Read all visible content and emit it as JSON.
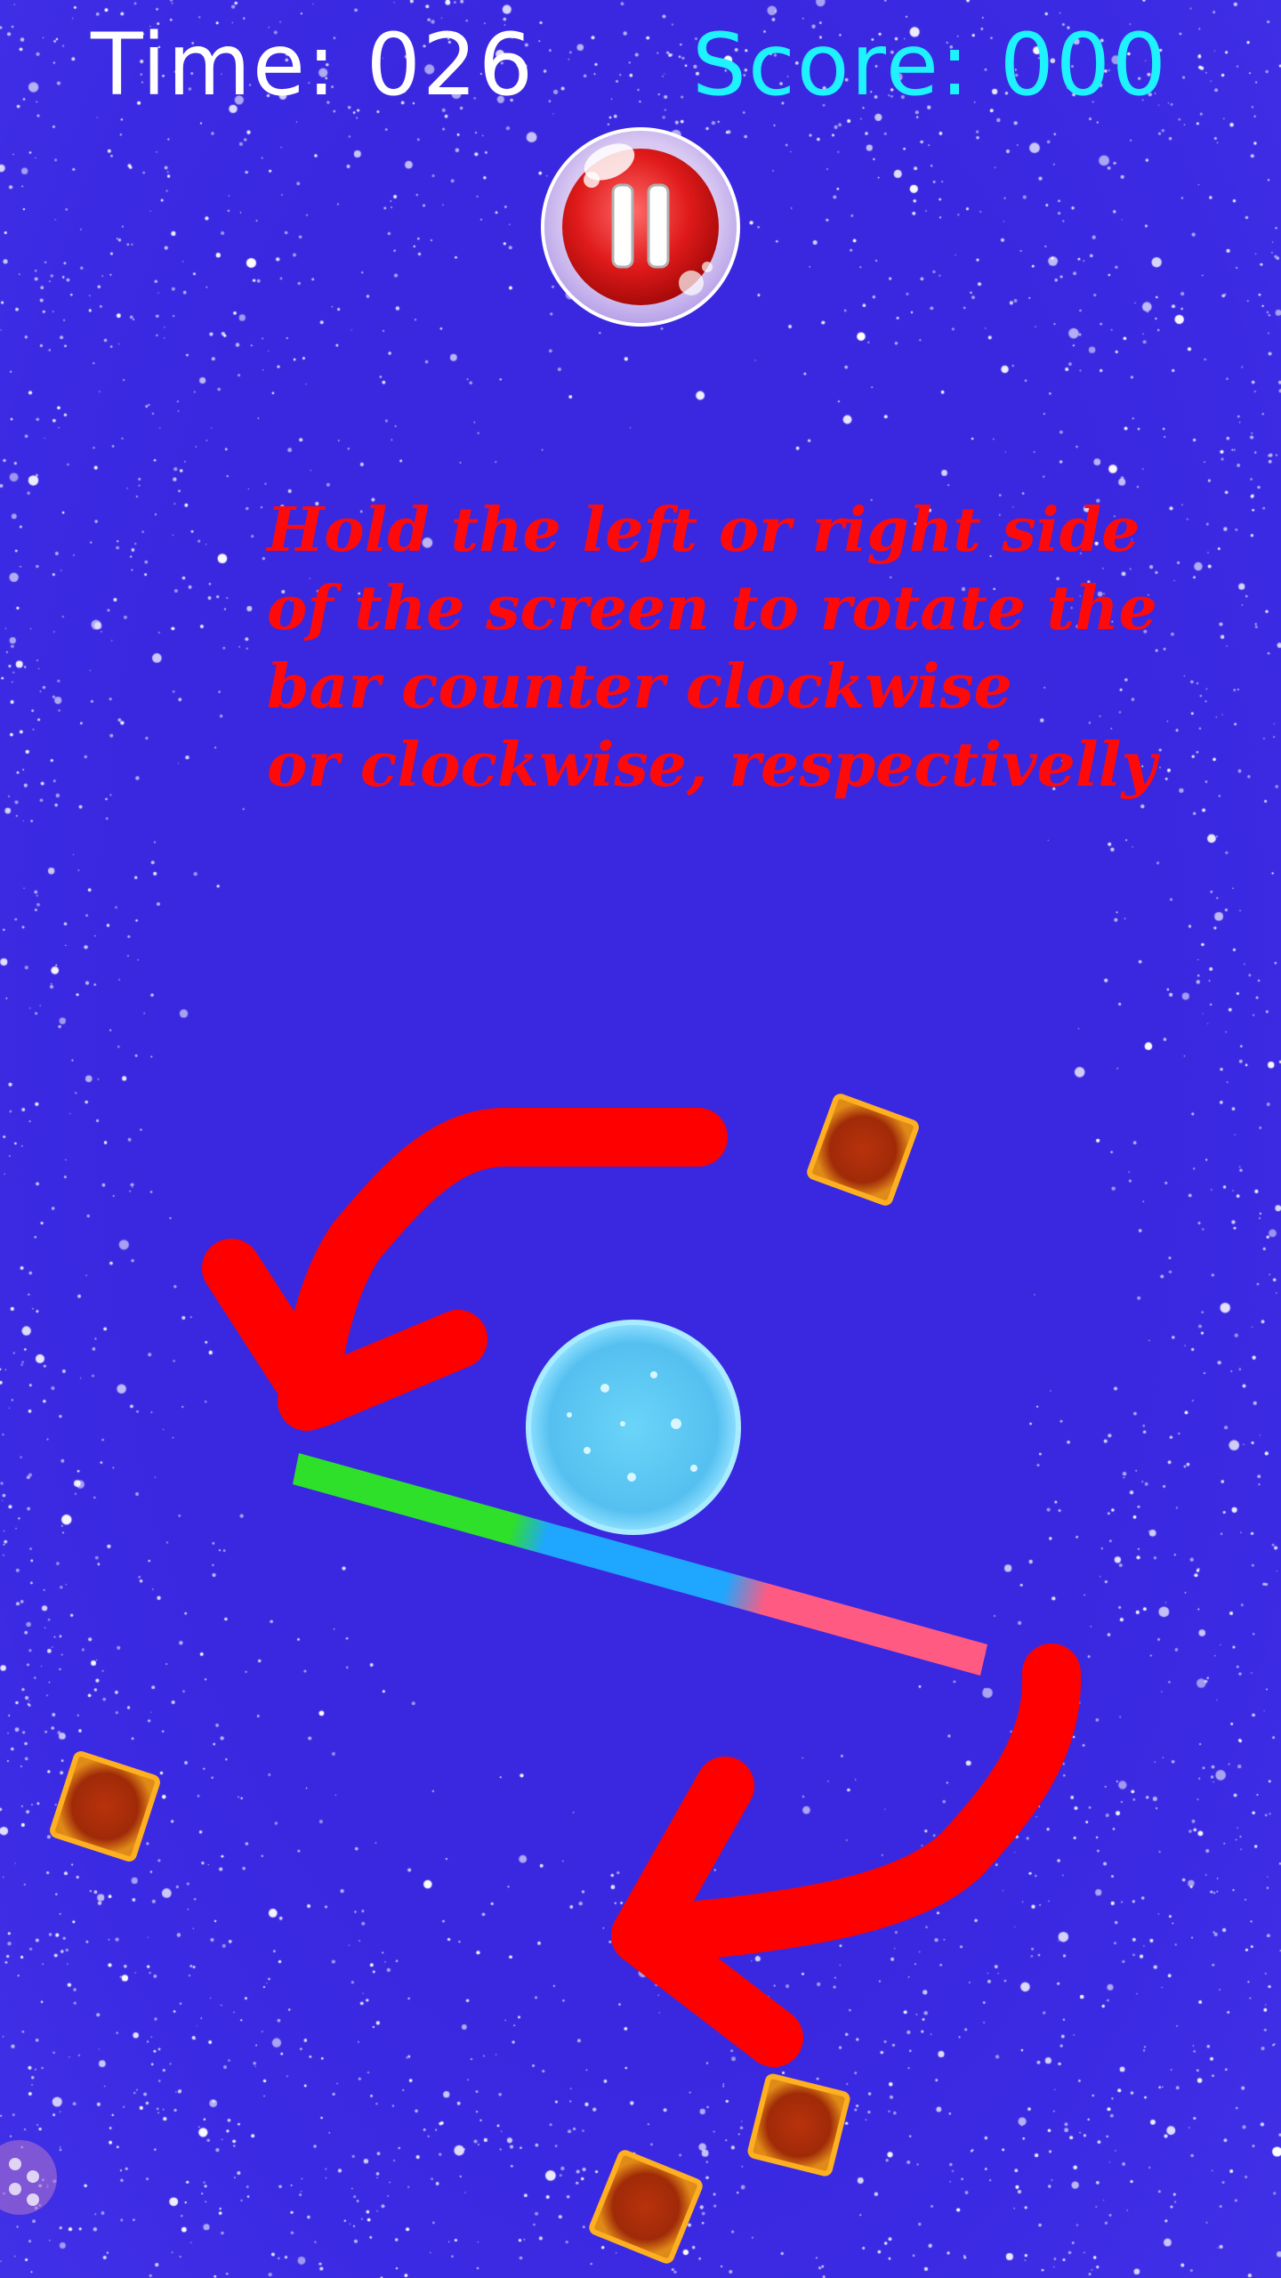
{
  "hud": {
    "time_label": "Time: 026",
    "score_label": "Score: 000"
  },
  "instructions": {
    "lines": [
      "Hold the left or right side",
      "of the screen to rotate the",
      "bar counter clockwise",
      "or clockwise, respectivelly"
    ]
  },
  "colors": {
    "background": "#3a28e0",
    "time_text": "#ffffff",
    "score_text": "#1ff2ff",
    "instruction_text": "#ff0a0a",
    "arrow": "#ff0000",
    "bar_green": "#2ee02a",
    "bar_blue": "#1fa6ff",
    "bar_pink": "#ff5a82",
    "ball": "#5fc8f5",
    "block": "#b8320c"
  },
  "icons": {
    "pause": "pause-icon",
    "menu": "grid-dots-icon"
  }
}
